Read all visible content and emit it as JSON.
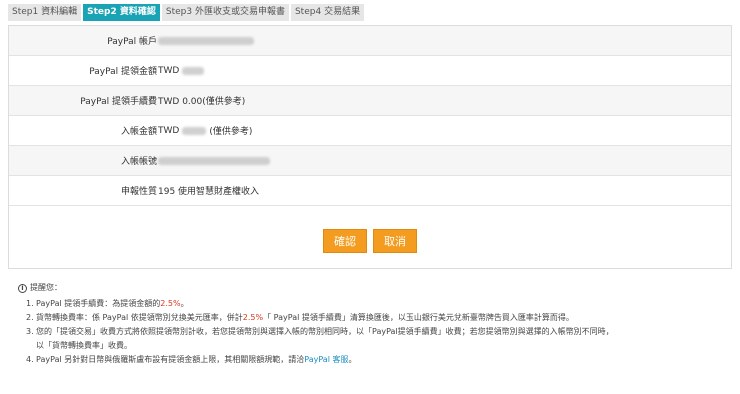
{
  "steps": [
    {
      "num": "Step1",
      "label": "資料編輯"
    },
    {
      "num": "Step2",
      "label": "資料確認"
    },
    {
      "num": "Step3",
      "label": "外匯收支或交易申報書"
    },
    {
      "num": "Step4",
      "label": "交易結果"
    }
  ],
  "active_step": 1,
  "rows": {
    "account_label": "PayPal 帳戶",
    "amount_label": "PayPal 提領金額",
    "amount_prefix": "TWD",
    "fee_label": "PayPal 提領手續費",
    "fee_value": "TWD 0.00(僅供參考)",
    "deposit_amount_label": "入帳金額",
    "deposit_prefix": "TWD",
    "deposit_suffix": "(僅供參考)",
    "deposit_account_label": "入帳帳號",
    "nature_label": "申報性質",
    "nature_value": "195 使用智慧財產權收入"
  },
  "buttons": {
    "confirm": "確認",
    "cancel": "取消"
  },
  "notes": {
    "title": "提醒您：",
    "n1_num": "1.",
    "n1_text": "PayPal 提領手續費：為提領金額的",
    "n1_rate": "2.5%",
    "n1_end": "。",
    "n2_num": "2.",
    "n2_a": "貨幣轉換費率：係 PayPal 依提領幣別兌換美元匯率，併計",
    "n2_rate": "2.5%",
    "n2_b": "「 PayPal 提領手續費」清算換匯後，以玉山銀行美元兌新臺幣牌告買入匯率計算而得。",
    "n3_num": "3.",
    "n3_a": "您的「提領交易」收費方式將依照提領幣別計收，若您提領幣別與選擇入帳的幣別相同時，以「PayPal提領手續費」收費；若您提領幣別與選擇的入帳幣別不同時，",
    "n3_b": "以「貨幣轉換費率」收費。",
    "n4_num": "4.",
    "n4_a": "PayPal 另針對日幣與俄羅斯盧布設有提領金額上限，其相關限額規範，請洽",
    "n4_link": "PayPal 客服",
    "n4_end": "。"
  },
  "colors": {
    "active_step": "#1aa3b5",
    "button": "#f39c1f",
    "highlight": "#d9391f",
    "link": "#1a8fc2"
  }
}
